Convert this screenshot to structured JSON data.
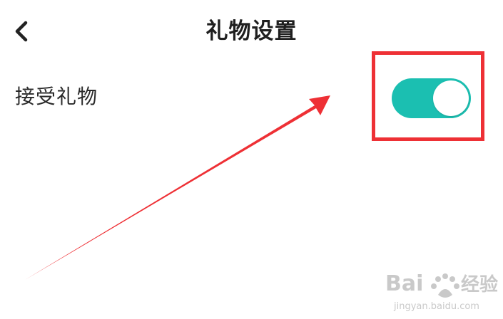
{
  "header": {
    "title": "礼物设置",
    "back_icon": "chevron-left-icon"
  },
  "settings": {
    "accept_gifts": {
      "label": "接受礼物",
      "enabled": true
    }
  },
  "colors": {
    "toggle_on": "#1bbfb1",
    "annotation_red": "#ee3035",
    "title_text": "#1f1f1f",
    "label_text": "#2a2a2a"
  },
  "watermark": {
    "brand": "Baidu经验",
    "domain": "jingyan.baidu.com"
  }
}
